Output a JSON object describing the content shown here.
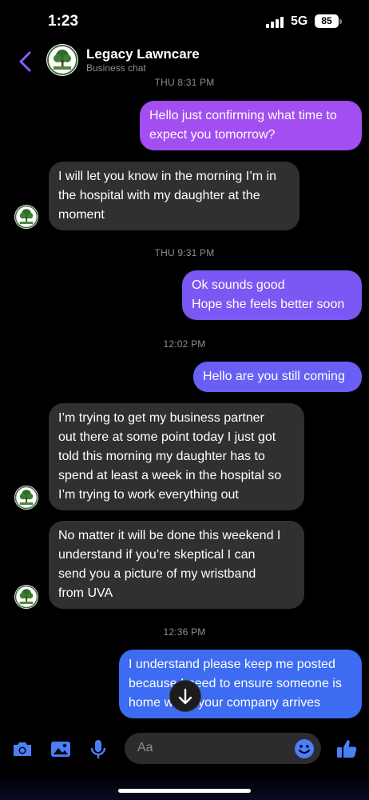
{
  "status": {
    "time": "1:23",
    "network": "5G",
    "battery": "85"
  },
  "header": {
    "title": "Legacy Lawncare",
    "subtitle": "Business chat"
  },
  "messages": {
    "ts1": "THU 8:31 PM",
    "m1": [
      "Hello just confirming what time to",
      "expect you tomorrow?"
    ],
    "m2": [
      "I will let you know in the morning I’m in",
      "the hospital with my daughter at the",
      "moment"
    ],
    "ts2": "THU 9:31 PM",
    "m3": [
      "Ok sounds good",
      "Hope she feels better soon"
    ],
    "ts3": "12:02 PM",
    "m4": [
      "Hello are you still coming"
    ],
    "m5": [
      "I’m trying to get my business partner",
      "out there at some point today I just got",
      "told this morning my daughter has to",
      "spend at least a week in the hospital so",
      "I’m trying to work everything out"
    ],
    "m6": [
      "No matter it will be done this weekend I",
      "understand if you’re skeptical I can",
      "send you a picture of my wristband",
      "from UVA"
    ],
    "ts4": "12:36 PM",
    "m7": [
      "I understand please keep me posted",
      "because I need to ensure someone is",
      "home when your company arrives"
    ]
  },
  "composer": {
    "placeholder": "Aa"
  },
  "colors": {
    "accent": "#8e5cf5",
    "outgoing_top": "#a34ef0",
    "outgoing_bottom": "#3d6cf2",
    "incoming": "#303030"
  }
}
